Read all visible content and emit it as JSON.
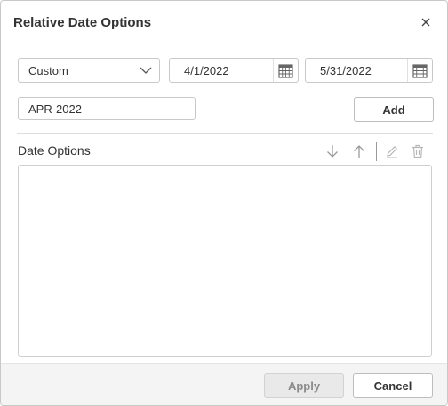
{
  "dialog": {
    "title": "Relative Date Options",
    "close_icon": "close-icon"
  },
  "options": {
    "range_type": "Custom",
    "start_date": "4/1/2022",
    "end_date": "5/31/2022",
    "label_value": "APR-2022",
    "add_label": "Add"
  },
  "date_options": {
    "label": "Date Options",
    "tools": [
      "arrow-down-icon",
      "arrow-up-icon",
      "pencil-icon",
      "trash-icon"
    ],
    "items": []
  },
  "footer": {
    "apply_label": "Apply",
    "cancel_label": "Cancel"
  },
  "colors": {
    "border": "#c9c9c9",
    "disabled_button": "#e9e9e9",
    "footer_bg": "#f4f4f4"
  }
}
